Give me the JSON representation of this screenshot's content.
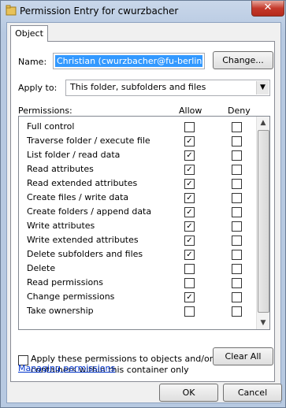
{
  "window": {
    "title": "Permission Entry for cwurzbacher",
    "close_label": "✕"
  },
  "tabs": [
    {
      "label": "Object"
    }
  ],
  "name": {
    "label": "Name:",
    "value": "Christian (cwurzbacher@fu-berlin.de)",
    "change_button": "Change..."
  },
  "apply_to": {
    "label": "Apply to:",
    "selected": "This folder, subfolders and files"
  },
  "permissions": {
    "header": "Permissions:",
    "allow_header": "Allow",
    "deny_header": "Deny",
    "rows": [
      {
        "name": "Full control",
        "allow": false,
        "deny": false
      },
      {
        "name": "Traverse folder / execute file",
        "allow": true,
        "deny": false
      },
      {
        "name": "List folder / read data",
        "allow": true,
        "deny": false
      },
      {
        "name": "Read attributes",
        "allow": true,
        "deny": false
      },
      {
        "name": "Read extended attributes",
        "allow": true,
        "deny": false
      },
      {
        "name": "Create files / write data",
        "allow": true,
        "deny": false
      },
      {
        "name": "Create folders / append data",
        "allow": true,
        "deny": false
      },
      {
        "name": "Write attributes",
        "allow": true,
        "deny": false
      },
      {
        "name": "Write extended attributes",
        "allow": true,
        "deny": false
      },
      {
        "name": "Delete subfolders and files",
        "allow": true,
        "deny": false
      },
      {
        "name": "Delete",
        "allow": false,
        "deny": false
      },
      {
        "name": "Read permissions",
        "allow": false,
        "deny": false
      },
      {
        "name": "Change permissions",
        "allow": true,
        "deny": false
      },
      {
        "name": "Take ownership",
        "allow": false,
        "deny": false
      }
    ]
  },
  "apply_inherit": {
    "line1": "Apply these permissions to objects and/or",
    "line2": "containers within this container only",
    "checked": false
  },
  "clear_all_button": "Clear All",
  "managing_link": "Managing permissions",
  "ok_button": "OK",
  "cancel_button": "Cancel"
}
